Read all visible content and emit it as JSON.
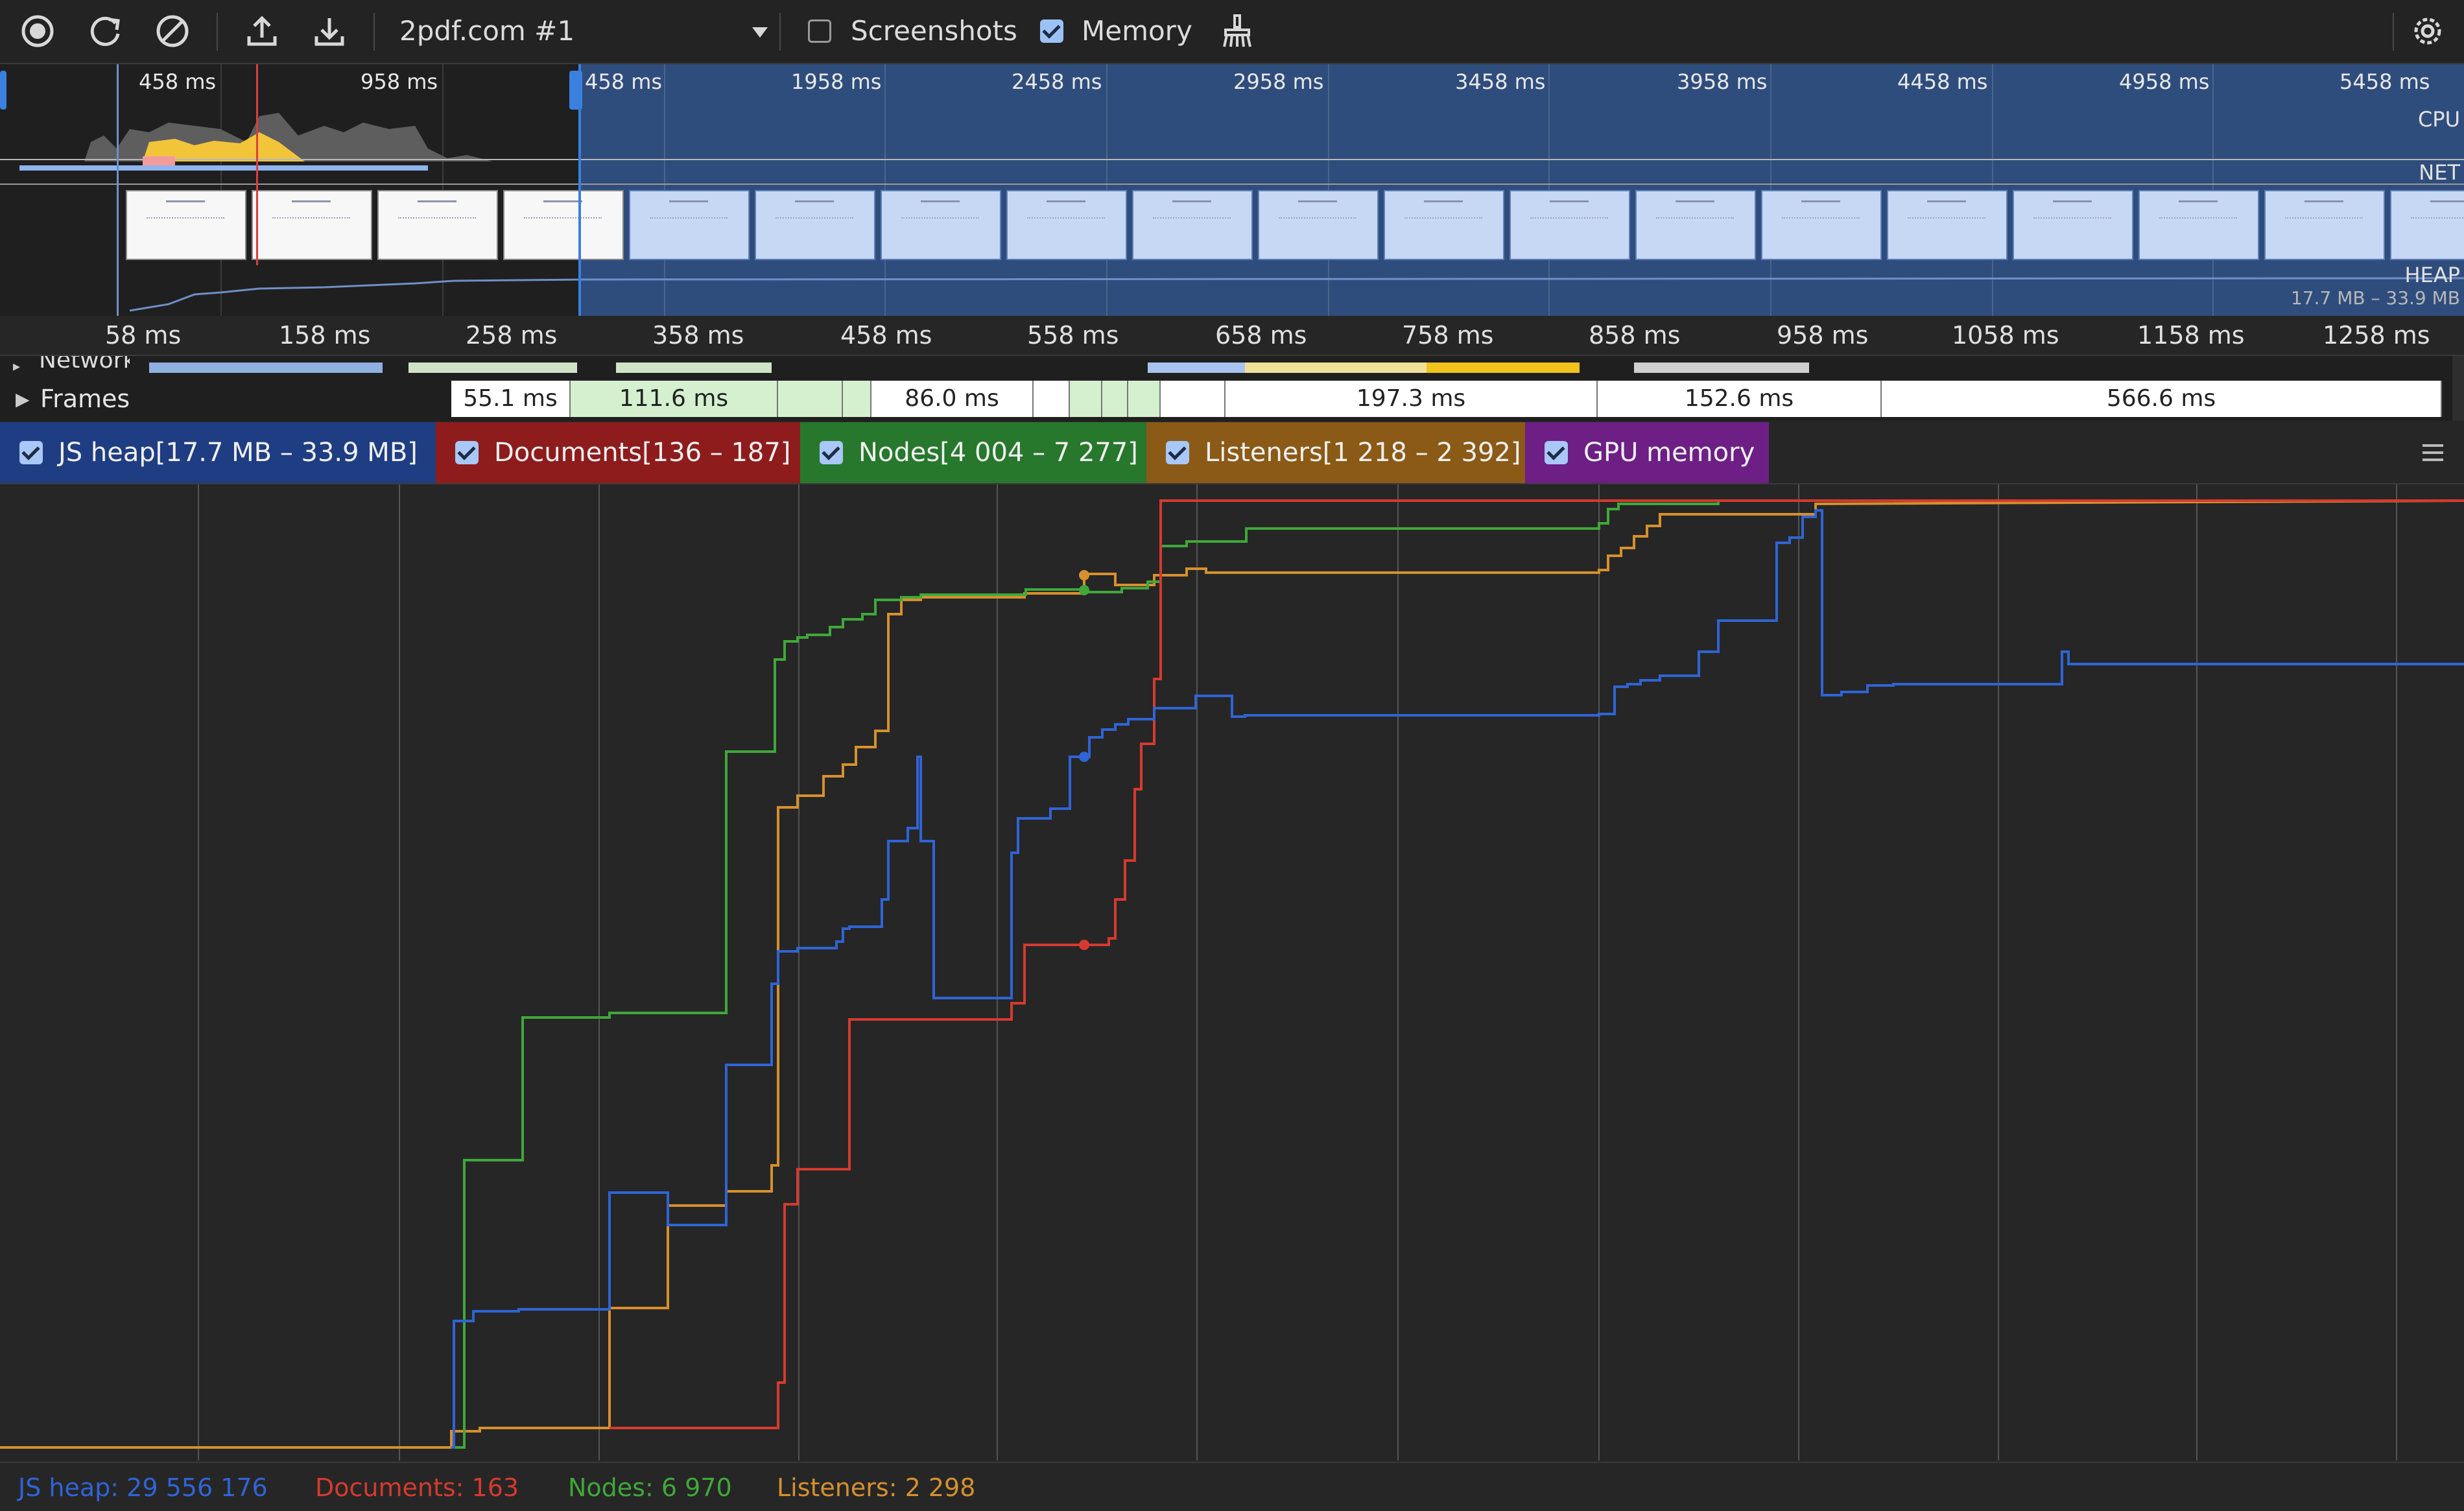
{
  "toolbar": {
    "profile_name": "2pdf.com #1",
    "screenshots_label": "Screenshots",
    "screenshots_checked": false,
    "memory_label": "Memory",
    "memory_checked": true
  },
  "overview": {
    "ticks": [
      "458 ms",
      "958 ms",
      "458 ms",
      "1958 ms",
      "2458 ms",
      "2958 ms",
      "3458 ms",
      "3958 ms",
      "4458 ms",
      "4958 ms",
      "5458 ms"
    ],
    "labels": {
      "cpu": "CPU",
      "net": "NET",
      "heap": "HEAP"
    },
    "heap_range": "17.7 MB – 33.9 MB"
  },
  "ruler": {
    "ticks": [
      "58 ms",
      "158 ms",
      "258 ms",
      "358 ms",
      "458 ms",
      "558 ms",
      "658 ms",
      "758 ms",
      "858 ms",
      "958 ms",
      "1058 ms",
      "1158 ms",
      "1258 ms"
    ]
  },
  "tracks": {
    "frames_label": "Frames",
    "network_label": "Network",
    "frames": [
      {
        "label": "55.1 ms",
        "color": "#ffffff"
      },
      {
        "label": "111.6 ms",
        "color": "#d4f0cf"
      },
      {
        "label": "86.0 ms",
        "color": "#ffffff"
      },
      {
        "label": "197.3 ms",
        "color": "#ffffff"
      },
      {
        "label": "152.6 ms",
        "color": "#ffffff"
      },
      {
        "label": "566.6 ms",
        "color": "#ffffff"
      }
    ]
  },
  "legend": [
    {
      "label": "JS heap[17.7 MB – 33.9 MB]",
      "color": "#1f3d82"
    },
    {
      "label": "Documents[136 – 187]",
      "color": "#8e1c1c"
    },
    {
      "label": "Nodes[4 004 – 7 277]",
      "color": "#27782c"
    },
    {
      "label": "Listeners[1 218 – 2 392]",
      "color": "#8a5a16"
    },
    {
      "label": "GPU memory",
      "color": "#6d1f86"
    }
  ],
  "status": {
    "js_heap": "JS heap: 29 556 176",
    "documents": "Documents: 163",
    "nodes": "Nodes: 6 970",
    "listeners": "Listeners: 2 298"
  },
  "colors": {
    "js_heap": "#2f64d6",
    "documents": "#d63a2e",
    "nodes": "#3fa83a",
    "listeners": "#d6902e"
  },
  "icons": [
    "record-icon",
    "reload-icon",
    "clear-icon",
    "upload-icon",
    "download-icon",
    "dropdown-arrow-icon",
    "broom-icon",
    "gear-icon",
    "expand-arrow-icon",
    "menu-icon"
  ]
}
